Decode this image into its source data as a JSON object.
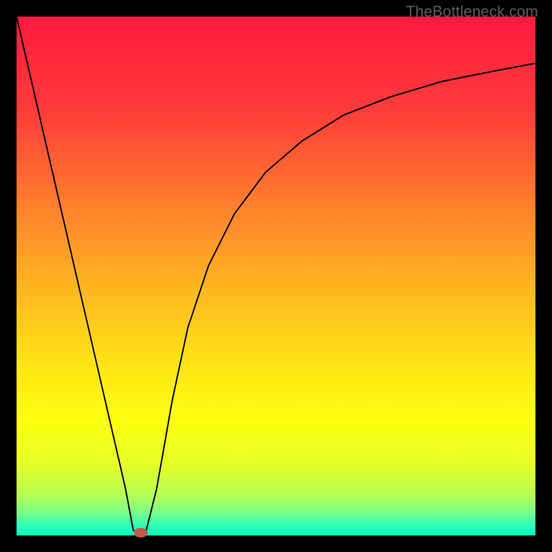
{
  "watermark": "TheBottleneck.com",
  "chart_data": {
    "type": "line",
    "title": "",
    "xlabel": "",
    "ylabel": "",
    "xlim": [
      0,
      100
    ],
    "ylim": [
      0,
      100
    ],
    "grid": false,
    "legend": false,
    "background_gradient_stops": [
      {
        "pos": 0.0,
        "color": "#ff1a3f"
      },
      {
        "pos": 0.18,
        "color": "#ff3b3a"
      },
      {
        "pos": 0.35,
        "color": "#ff7a2e"
      },
      {
        "pos": 0.52,
        "color": "#ffb521"
      },
      {
        "pos": 0.68,
        "color": "#ffe714"
      },
      {
        "pos": 0.78,
        "color": "#fdff0e"
      },
      {
        "pos": 0.86,
        "color": "#e7ff26"
      },
      {
        "pos": 0.92,
        "color": "#b7ff54"
      },
      {
        "pos": 0.955,
        "color": "#7dff86"
      },
      {
        "pos": 0.978,
        "color": "#35ffb4"
      },
      {
        "pos": 1.0,
        "color": "#00ffc2"
      }
    ],
    "series": [
      {
        "name": "bottleneck-curve",
        "color": "#000000",
        "x": [
          0,
          3,
          6,
          9,
          12,
          15,
          18,
          21,
          22.5,
          24,
          25,
          27,
          30,
          33,
          37,
          42,
          48,
          55,
          63,
          72,
          82,
          92,
          100
        ],
        "y": [
          100,
          87,
          74,
          61,
          48,
          35,
          22,
          9,
          1,
          0.5,
          1,
          9,
          26,
          40,
          52,
          62,
          70,
          76,
          81,
          84.5,
          87.5,
          89.5,
          91
        ]
      }
    ],
    "marker": {
      "name": "optimum-point",
      "x": 24,
      "y": 0.5,
      "color": "#c25a4a",
      "rx": 10,
      "ry": 7
    }
  }
}
